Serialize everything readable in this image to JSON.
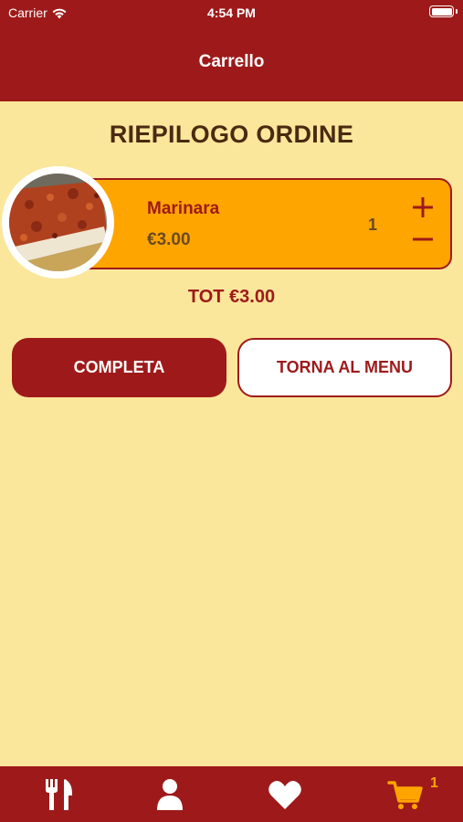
{
  "status_bar": {
    "carrier": "Carrier",
    "time": "4:54 PM",
    "icons": [
      "wifi-icon",
      "battery-icon"
    ]
  },
  "nav": {
    "title": "Carrello"
  },
  "order": {
    "title": "RIEPILOGO ORDINE",
    "items": [
      {
        "name": "Marinara",
        "price": "€3.00",
        "quantity": "1",
        "photo": "pizza-marinara-photo"
      }
    ],
    "total": "TOT €3.00"
  },
  "actions": {
    "complete_label": "COMPLETA",
    "back_label": "TORNA AL MENU"
  },
  "tabbar": {
    "items": [
      {
        "icon": "fork-knife-icon",
        "selected": false
      },
      {
        "icon": "user-icon",
        "selected": false
      },
      {
        "icon": "heart-icon",
        "selected": false
      },
      {
        "icon": "cart-icon",
        "selected": true
      }
    ],
    "cart_badge": "1"
  },
  "colors": {
    "primary": "#9E1A1A",
    "background": "#FBE79B",
    "accent": "#FFA500",
    "text_dark": "#4A2A12"
  }
}
